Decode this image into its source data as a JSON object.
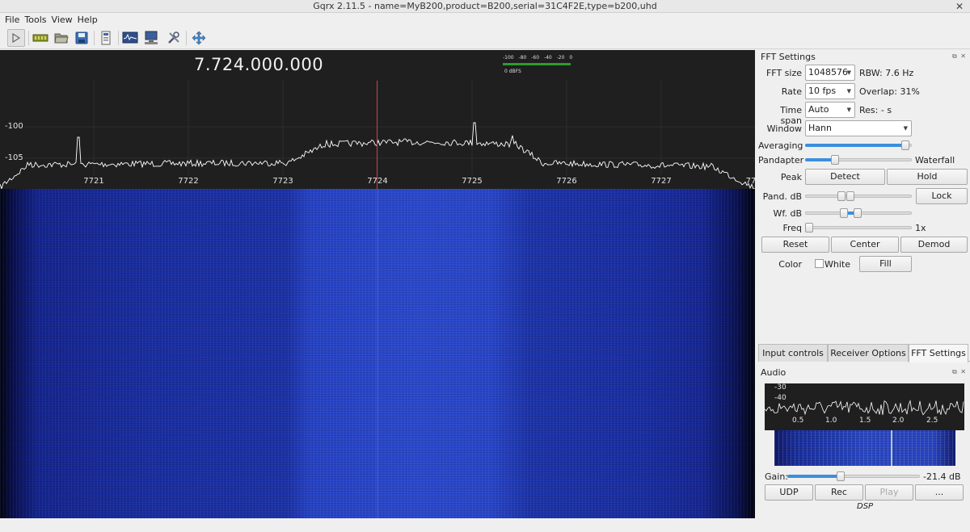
{
  "window": {
    "title": "Gqrx 2.11.5 - name=MyB200,product=B200,serial=31C4F2E,type=b200,uhd",
    "close_glyph": "✕"
  },
  "menu": [
    "File",
    "Tools",
    "View",
    "Help"
  ],
  "toolbar": {
    "buttons": [
      "play-icon",
      "hardware-icon",
      "open-file-icon",
      "save-icon",
      "remote-icon",
      "fft-icon",
      "network-icon",
      "tools-icon",
      "fullscreen-icon"
    ]
  },
  "plotter": {
    "center_frequency": "7.724.000.000",
    "y_labels": [
      "-100",
      "-105"
    ],
    "x_labels": [
      "7721",
      "7722",
      "7723",
      "7724",
      "7725",
      "7726",
      "7727",
      "77"
    ],
    "dbfs_scale": "-100 -80 -60 -40 -20 0",
    "dbfs_unit": "0 dBFS",
    "colors": {
      "background": "#1f1f1f",
      "trace": "#ffffff",
      "center_line": "#d23c3c",
      "meter": "#2a9d2a"
    }
  },
  "fft_settings": {
    "title": "FFT Settings",
    "fft_size_label": "FFT size",
    "fft_size_value": "1048576",
    "rbw": "RBW: 7.6 Hz",
    "rate_label": "Rate",
    "rate_value": "10 fps",
    "overlap": "Overlap: 31%",
    "time_span_label": "Time span",
    "time_span_value": "Auto",
    "res": "Res: - s",
    "window_label": "Window",
    "window_value": "Hann",
    "averaging_label": "Averaging",
    "averaging_level": 0.94,
    "pandapter_label": "Pandapter",
    "waterfall_label": "Waterfall",
    "split_level": 0.28,
    "peak_label": "Peak",
    "detect_label": "Detect",
    "hold_label": "Hold",
    "pand_db_label": "Pand. dB",
    "lock_label": "Lock",
    "wf_db_label": "Wf. dB",
    "freq_zoom_label": "Freq zoom",
    "freq_zoom_value": "1x",
    "reset_label": "Reset",
    "center_label": "Center",
    "demod_label": "Demod",
    "color_label": "Color",
    "white_label": "White",
    "fill_label": "Fill"
  },
  "tabs": [
    "Input controls",
    "Receiver Options",
    "FFT Settings"
  ],
  "audio": {
    "title": "Audio",
    "fft_y_labels": [
      "-30",
      "-40"
    ],
    "fft_x_labels": [
      "0.5",
      "1.0",
      "1.5",
      "2.0",
      "2.5"
    ],
    "gain_label": "Gain:",
    "gain_value": "-21.4 dB",
    "gain_level": 0.4,
    "udp_label": "UDP",
    "rec_label": "Rec",
    "play_label": "Play",
    "more_label": "...",
    "dsp_label": "DSP"
  }
}
